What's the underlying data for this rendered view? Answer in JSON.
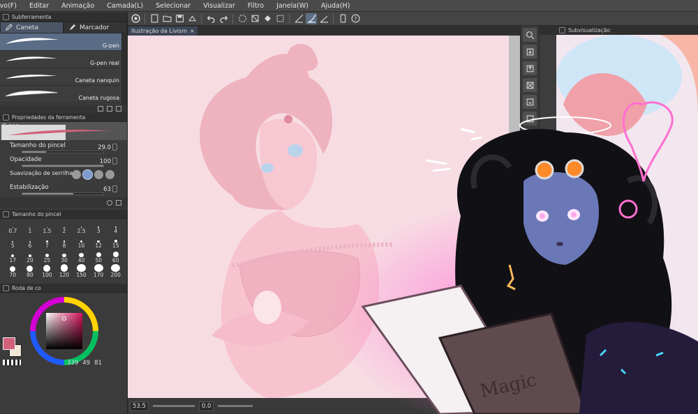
{
  "menu": [
    "ivo(F)",
    "Editar",
    "Animação",
    "Camada(L)",
    "Selecionar",
    "Visualizar",
    "Filtro",
    "Janela(W)",
    "Ajuda(H)"
  ],
  "subtool_panel": {
    "title": "Subferramenta",
    "tabs": [
      {
        "label": "Caneta",
        "icon": "pen-icon"
      },
      {
        "label": "Marcador",
        "icon": "marker-icon"
      }
    ],
    "brushes": [
      "G-pen",
      "G-pen real",
      "Caneta nanquin",
      "Caneta rugosa"
    ],
    "selected_brush": "G-pen"
  },
  "tool_properties": {
    "title": "Propriedades da ferramenta",
    "preview_name": "G-pen",
    "brush_size": {
      "label": "Tamanho do pincel",
      "value": "29.0",
      "level": 0.29
    },
    "opacity": {
      "label": "Opacidade",
      "value": "100",
      "level": 1.0
    },
    "smoothing": {
      "label": "Suavização de serrilhado"
    },
    "stabilization": {
      "label": "Estabilização",
      "value": "63",
      "level": 0.63
    }
  },
  "brush_size_panel": {
    "title": "Tamanho do pincel",
    "sizes": [
      "0.7",
      "1",
      "1.5",
      "2",
      "2.5",
      "3",
      "4",
      "5",
      "6",
      "7",
      "8",
      "10",
      "12",
      "15",
      "17",
      "20",
      "25",
      "30",
      "40",
      "50",
      "60",
      "70",
      "80",
      "100",
      "120",
      "150",
      "170",
      "200"
    ]
  },
  "color_panel": {
    "title": "Roda de co",
    "readout": [
      "339",
      "49",
      "81"
    ],
    "main_color": "#d2617b",
    "sub_color": "#f3e7d8"
  },
  "document": {
    "tab_label": "Ilustração da Livism",
    "close": "×"
  },
  "status": {
    "zoom": "53.5",
    "rotation": "0.0"
  },
  "navigator": {
    "title": "Subvisualização"
  },
  "colors": {
    "canvas_bg": "#f7dde3",
    "accent": "#5a6c86"
  }
}
